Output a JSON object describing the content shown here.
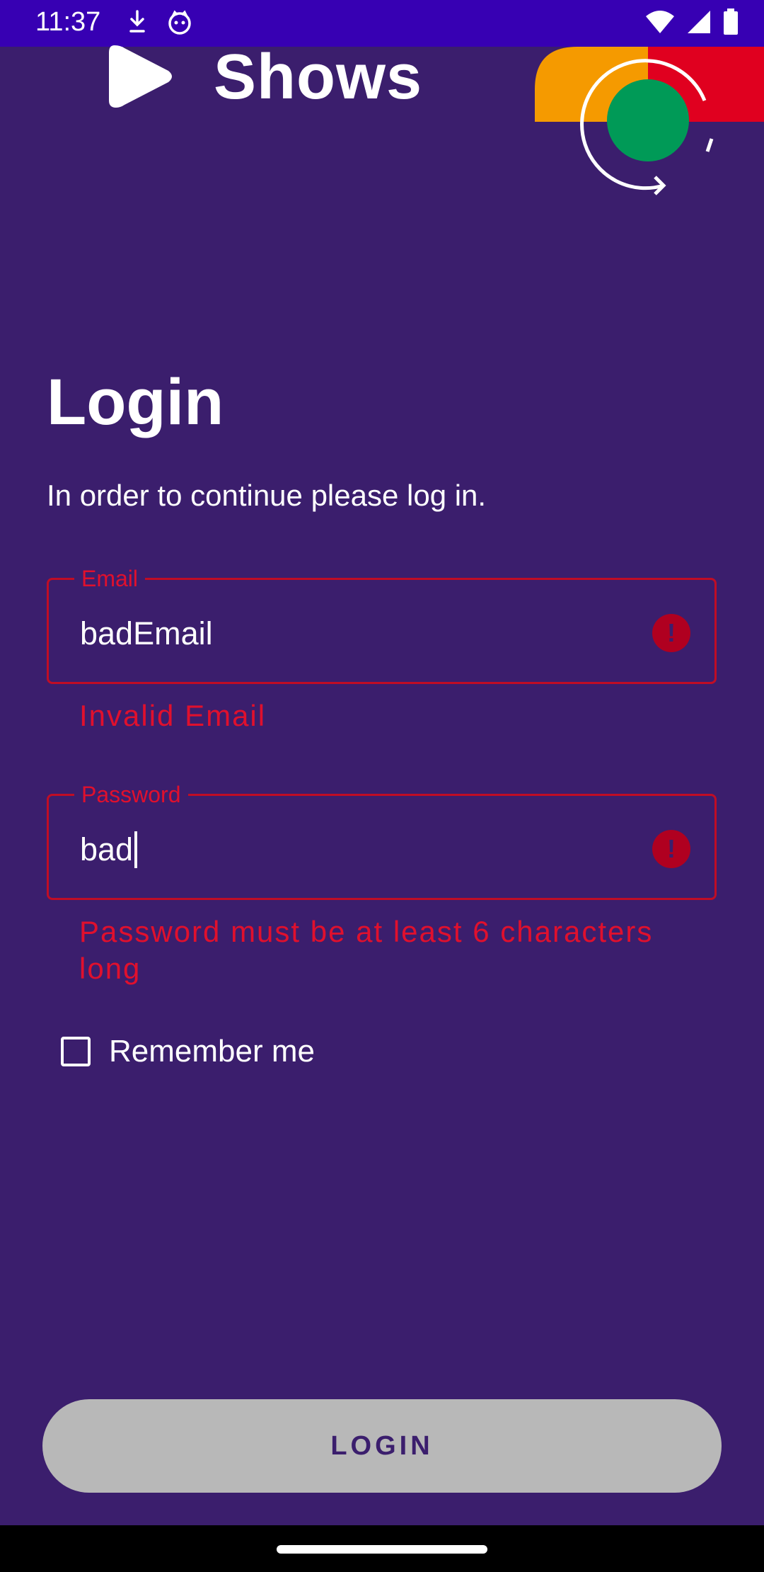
{
  "status_bar": {
    "time": "11:37",
    "icons": [
      "download-icon",
      "cat-icon",
      "wifi-icon",
      "signal-icon",
      "battery-icon"
    ]
  },
  "header": {
    "app_name": "Shows",
    "logo_icon": "play-icon"
  },
  "login": {
    "title": "Login",
    "subtitle": "In order to continue please log in."
  },
  "email_field": {
    "label": "Email",
    "value": "badEmail",
    "error": "Invalid Email"
  },
  "password_field": {
    "label": "Password",
    "value": "bad",
    "error": "Password must be at least 6 characters long"
  },
  "remember_me": {
    "label": "Remember me",
    "checked": false
  },
  "login_button": {
    "label": "LOGIN"
  },
  "colors": {
    "background": "#3b1e6d",
    "status_bar": "#3700b3",
    "error": "#e0102d",
    "button_disabled": "#b8b8b8",
    "deco_orange": "#f59a00",
    "deco_red": "#e0001f",
    "deco_green": "#009a57"
  }
}
